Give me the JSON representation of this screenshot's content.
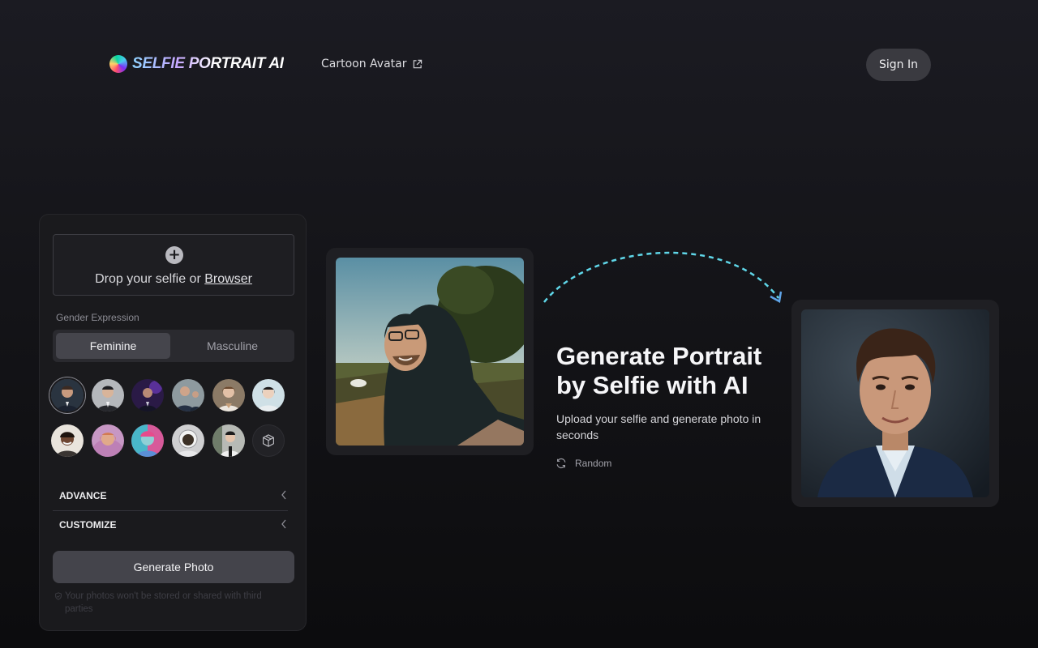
{
  "header": {
    "logo_text": "SELFIE PORTRAIT AI",
    "nav_link": "Cartoon Avatar",
    "sign_in": "Sign In"
  },
  "upload": {
    "prompt": "Drop your selfie or ",
    "browse_link": "Browser"
  },
  "gender": {
    "label": "Gender Expression",
    "options": [
      "Feminine",
      "Masculine"
    ],
    "selected": "Feminine"
  },
  "styles": {
    "row1": [
      "style-business-dark",
      "style-suit-grey",
      "style-purple-light",
      "style-group-suits",
      "style-blazer-warm",
      "style-asian-portrait"
    ],
    "row2": [
      "style-cheerful",
      "style-pink-glow",
      "style-colorful-paint",
      "style-astronaut",
      "style-street",
      "style-custom-cube"
    ]
  },
  "accordions": {
    "advance": "ADVANCE",
    "customize": "CUSTOMIZE"
  },
  "generate_button": "Generate Photo",
  "privacy_note": "Your photos won't be stored or shared with third parties",
  "hero": {
    "title": "Generate Portrait by Selfie with AI",
    "subtitle": "Upload your selfie and generate photo in seconds",
    "random_label": "Random"
  },
  "colors": {
    "accent_arrow": "#5fd6e8",
    "panel_bg": "#1a1a1d",
    "button_bg": "#44444b"
  }
}
